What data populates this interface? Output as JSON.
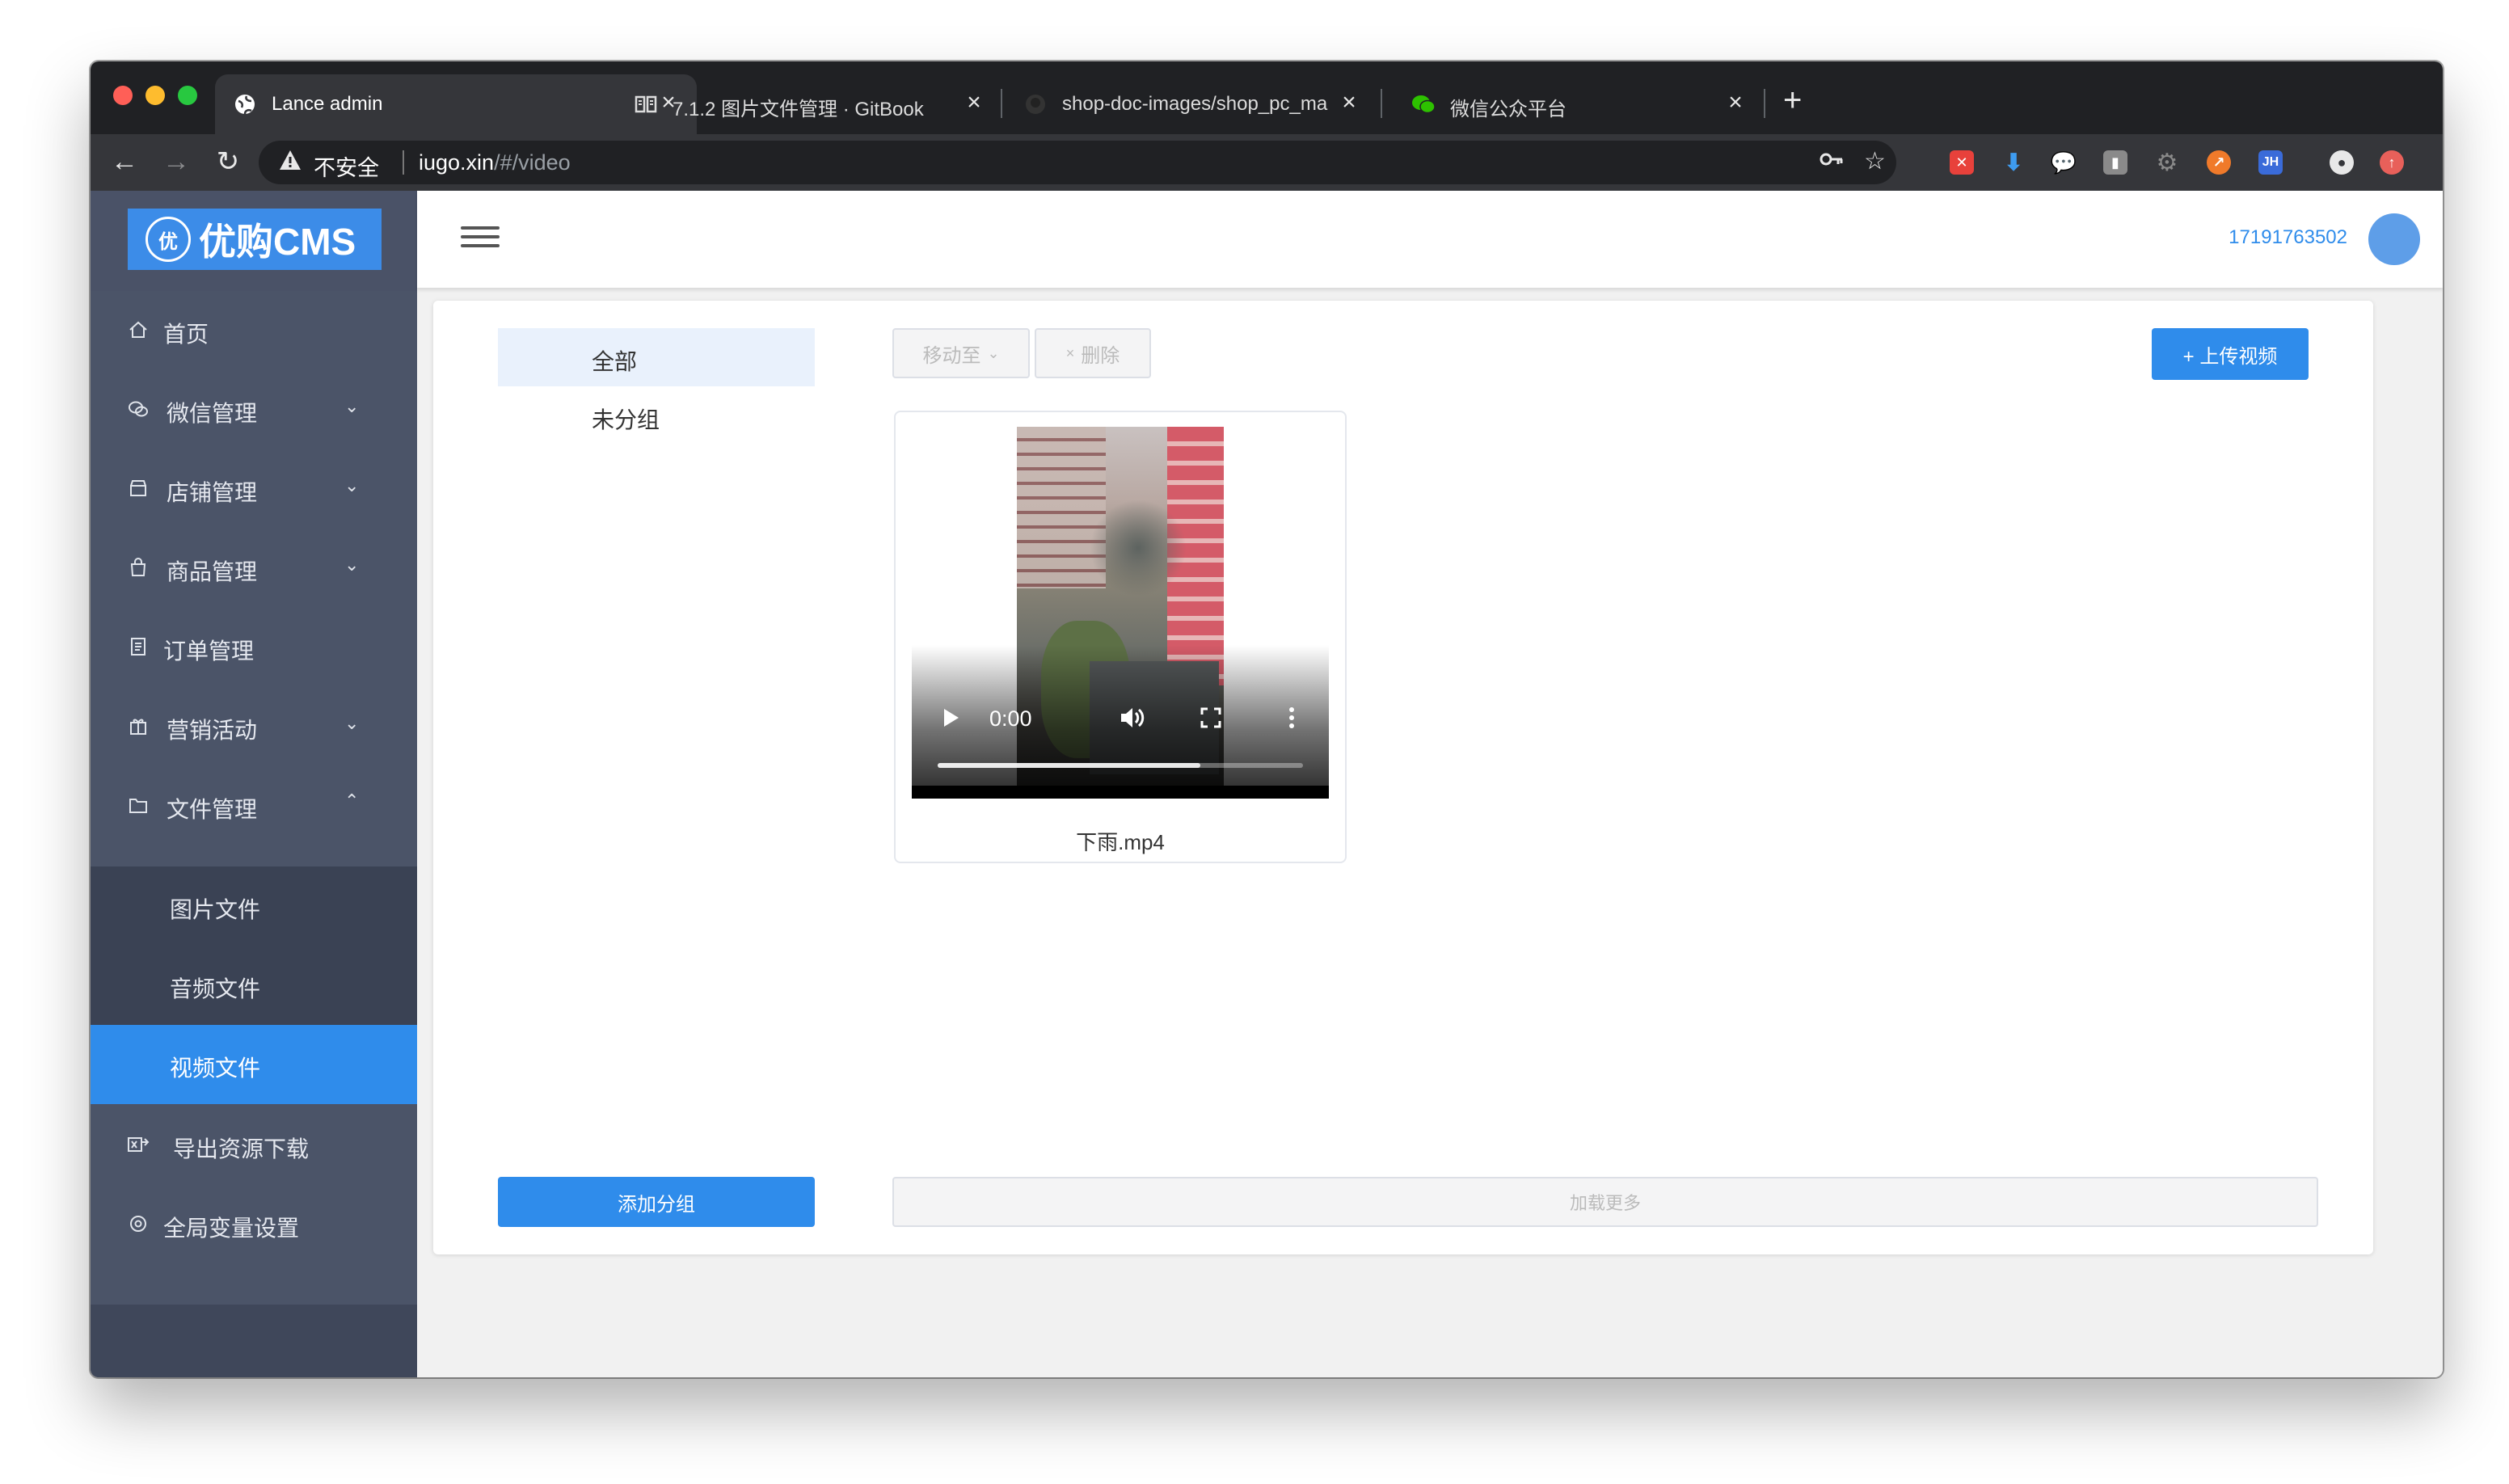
{
  "browser": {
    "tabs": [
      {
        "title": "Lance admin",
        "active": true
      },
      {
        "title": "7.1.2 图片文件管理 · GitBook",
        "active": false
      },
      {
        "title": "shop-doc-images/shop_pc_ma",
        "active": false
      },
      {
        "title": "微信公众平台",
        "active": false
      }
    ],
    "new_tab": "+",
    "close_glyph": "×",
    "insecure_label": "不安全",
    "url_host": "iugo.xin",
    "url_path": "/#/video"
  },
  "logo": {
    "badge": "优",
    "text": "优购CMS"
  },
  "sidebar": {
    "items": [
      {
        "label": "首页",
        "icon": "home-icon"
      },
      {
        "label": "微信管理",
        "icon": "wechat-icon",
        "chevron": "⌄"
      },
      {
        "label": "店铺管理",
        "icon": "store-icon",
        "chevron": "⌄"
      },
      {
        "label": "商品管理",
        "icon": "bag-icon",
        "chevron": "⌄"
      },
      {
        "label": "订单管理",
        "icon": "order-icon"
      },
      {
        "label": "营销活动",
        "icon": "gift-icon",
        "chevron": "⌄"
      },
      {
        "label": "文件管理",
        "icon": "folder-icon",
        "chevron": "⌃"
      },
      {
        "label": "导出资源下载",
        "icon": "export-icon"
      },
      {
        "label": "全局变量设置",
        "icon": "settings-icon"
      }
    ],
    "sub_items": [
      {
        "label": "图片文件"
      },
      {
        "label": "音频文件"
      },
      {
        "label": "视频文件",
        "active": true
      }
    ]
  },
  "header": {
    "phone": "17191763502"
  },
  "groups": {
    "items": [
      {
        "label": "全部",
        "active": true
      },
      {
        "label": "未分组",
        "active": false
      }
    ],
    "add_button": "添加分组"
  },
  "toolbar": {
    "move_label": "移动至",
    "delete_label": "删除",
    "delete_glyph": "×",
    "upload_label": "+ 上传视频"
  },
  "videos": [
    {
      "name": "下雨.mp4",
      "time": "0:00",
      "progress": 0.72
    }
  ],
  "load_more": "加载更多",
  "colors": {
    "accent": "#2f8ceb",
    "sidebar": "#4b5468",
    "sidebar_sub": "#3a4254"
  }
}
